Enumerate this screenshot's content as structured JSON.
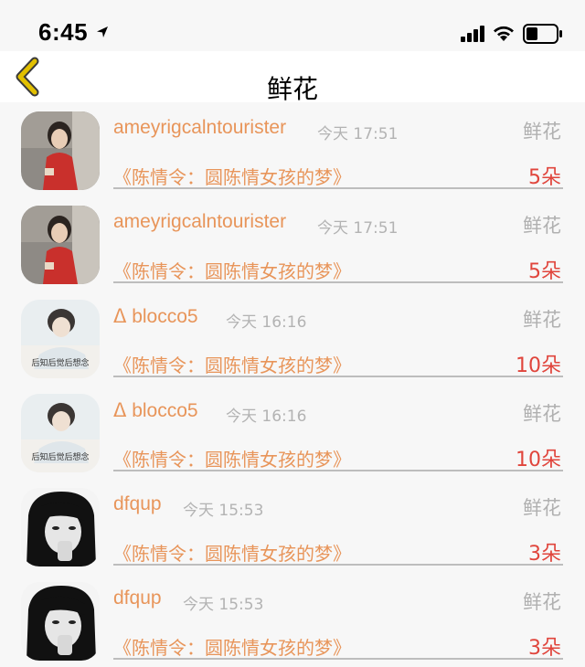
{
  "status_bar": {
    "time": "6:45",
    "icons": [
      "location-arrow-icon",
      "signal-bars-icon",
      "wifi-icon",
      "battery-icon"
    ]
  },
  "nav": {
    "title": "鲜花",
    "back_icon": "chevron-left-icon",
    "accent_color": "#e2c000"
  },
  "colors": {
    "name": "#e8955a",
    "count": "#e0453c",
    "muted": "#b3b3b3"
  },
  "items": [
    {
      "name": "ameyrigcalntourister",
      "time": "今天 17:51",
      "label": "鲜花",
      "book": "《陈情令：圆陈情女孩的梦》",
      "count": "5朵",
      "avatar": "girl-red-dress-avatar"
    },
    {
      "name": "ameyrigcalntourister",
      "time": "今天 17:51",
      "label": "鲜花",
      "book": "《陈情令：圆陈情女孩的梦》",
      "count": "5朵",
      "avatar": "girl-red-dress-avatar"
    },
    {
      "name": "ᐃ blocco5",
      "time": "今天 16:16",
      "label": "鲜花",
      "book": "《陈情令：圆陈情女孩的梦》",
      "count": "10朵",
      "avatar": "girl-sketch-avatar"
    },
    {
      "name": "ᐃ blocco5",
      "time": "今天 16:16",
      "label": "鲜花",
      "book": "《陈情令：圆陈情女孩的梦》",
      "count": "10朵",
      "avatar": "girl-sketch-avatar"
    },
    {
      "name": "dfqup",
      "time": "今天 15:53",
      "label": "鲜花",
      "book": "《陈情令：圆陈情女孩的梦》",
      "count": "3朵",
      "avatar": "bw-portrait-avatar"
    },
    {
      "name": "dfqup",
      "time": "今天 15:53",
      "label": "鲜花",
      "book": "《陈情令：圆陈情女孩的梦》",
      "count": "3朵",
      "avatar": "bw-portrait-avatar"
    }
  ],
  "avatar_captions": {
    "sketch": "后知后觉后想念"
  }
}
